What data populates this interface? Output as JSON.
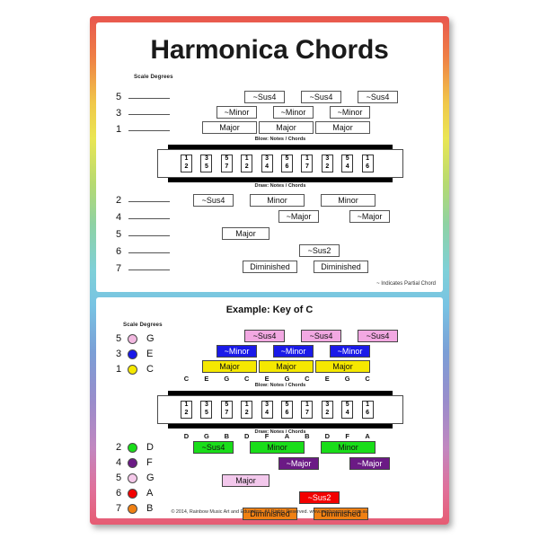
{
  "poster": {
    "title": "Harmonica Chords",
    "scale_degrees_label": "Scale Degrees",
    "partial_note": "~ Indicates Partial Chord",
    "example_title": "Example: Key of C",
    "footer": "© 2014, Rainbow Music Art and Education.  All Rights Reserved. www.rainbowmusic.com.au",
    "blow_label": "Blow: Notes / Chords",
    "draw_label": "Draw: Notes / Chords"
  },
  "harmonica": {
    "holes": [
      {
        "blow": "1",
        "draw": "2"
      },
      {
        "blow": "3",
        "draw": "5"
      },
      {
        "blow": "5",
        "draw": "7"
      },
      {
        "blow": "1",
        "draw": "2"
      },
      {
        "blow": "3",
        "draw": "4"
      },
      {
        "blow": "5",
        "draw": "6"
      },
      {
        "blow": "1",
        "draw": "7"
      },
      {
        "blow": "3",
        "draw": "2"
      },
      {
        "blow": "5",
        "draw": "4"
      },
      {
        "blow": "1",
        "draw": "6"
      }
    ]
  },
  "top_panel": {
    "blow_degrees": [
      {
        "num": "5"
      },
      {
        "num": "3"
      },
      {
        "num": "1"
      }
    ],
    "draw_degrees": [
      {
        "num": "2"
      },
      {
        "num": "4"
      },
      {
        "num": "5"
      },
      {
        "num": "6"
      },
      {
        "num": "7"
      }
    ],
    "blow_chords": [
      {
        "label": "~Sus4"
      },
      {
        "label": "~Sus4"
      },
      {
        "label": "~Sus4"
      },
      {
        "label": "~Minor"
      },
      {
        "label": "~Minor"
      },
      {
        "label": "~Minor"
      },
      {
        "label": "Major"
      },
      {
        "label": "Major"
      },
      {
        "label": "Major"
      }
    ],
    "draw_chords": [
      {
        "label": "~Sus4"
      },
      {
        "label": "Minor"
      },
      {
        "label": "Minor"
      },
      {
        "label": "~Major"
      },
      {
        "label": "~Major"
      },
      {
        "label": "Major"
      },
      {
        "label": "~Sus2"
      },
      {
        "label": "Diminished"
      },
      {
        "label": "Diminished"
      }
    ]
  },
  "bottom_panel": {
    "blow_legend": [
      {
        "num": "5",
        "note": "G",
        "color": "#f2b8e0"
      },
      {
        "num": "3",
        "note": "E",
        "color": "#1818e8"
      },
      {
        "num": "1",
        "note": "C",
        "color": "#f5e800"
      }
    ],
    "draw_legend": [
      {
        "num": "2",
        "note": "D",
        "color": "#19dd19"
      },
      {
        "num": "4",
        "note": "F",
        "color": "#6b1a85"
      },
      {
        "num": "5",
        "note": "G",
        "color": "#f5c9ea"
      },
      {
        "num": "6",
        "note": "A",
        "color": "#f20000"
      },
      {
        "num": "7",
        "note": "B",
        "color": "#f08013"
      }
    ],
    "blow_notes": [
      "C",
      "E",
      "G",
      "C",
      "E",
      "G",
      "C",
      "E",
      "G",
      "C"
    ],
    "draw_notes": [
      "D",
      "G",
      "B",
      "D",
      "F",
      "A",
      "B",
      "D",
      "F",
      "A"
    ],
    "blow_chords": [
      {
        "label": "~Sus4",
        "color": "#f2a8e2"
      },
      {
        "label": "~Sus4",
        "color": "#f2a8e2"
      },
      {
        "label": "~Sus4",
        "color": "#f2a8e2"
      },
      {
        "label": "~Minor",
        "color": "#1a1ae8"
      },
      {
        "label": "~Minor",
        "color": "#1a1ae8"
      },
      {
        "label": "~Minor",
        "color": "#1a1ae8"
      },
      {
        "label": "Major",
        "color": "#f5e800"
      },
      {
        "label": "Major",
        "color": "#f5e800"
      },
      {
        "label": "Major",
        "color": "#f5e800"
      }
    ],
    "draw_chords": [
      {
        "label": "~Sus4",
        "color": "#19dd19"
      },
      {
        "label": "Minor",
        "color": "#19dd19"
      },
      {
        "label": "Minor",
        "color": "#19dd19"
      },
      {
        "label": "~Major",
        "color": "#6b1a85"
      },
      {
        "label": "~Major",
        "color": "#6b1a85"
      },
      {
        "label": "Major",
        "color": "#f3c8ec"
      },
      {
        "label": "~Sus2",
        "color": "#f20000"
      },
      {
        "label": "Diminished",
        "color": "#f08013"
      },
      {
        "label": "Diminished",
        "color": "#f08013"
      }
    ]
  }
}
